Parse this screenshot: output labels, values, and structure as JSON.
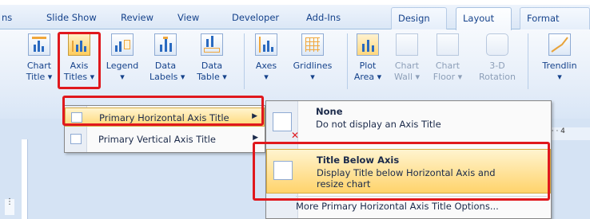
{
  "tabs": [
    "ns",
    "Slide Show",
    "Review",
    "View",
    "Developer",
    "Add-Ins",
    "Design",
    "Layout",
    "Format"
  ],
  "ribbon": {
    "chart_title": [
      "Chart",
      "Title ▾"
    ],
    "axis_titles": [
      "Axis",
      "Titles ▾"
    ],
    "legend": [
      "Legend",
      "▾"
    ],
    "data_labels": [
      "Data",
      "Labels ▾"
    ],
    "data_table": [
      "Data",
      "Table ▾"
    ],
    "axes": [
      "Axes",
      "▾"
    ],
    "gridlines": [
      "Gridlines",
      "▾"
    ],
    "plot_area": [
      "Plot",
      "Area ▾"
    ],
    "chart_wall": [
      "Chart",
      "Wall ▾"
    ],
    "chart_floor": [
      "Chart",
      "Floor ▾"
    ],
    "rotation": [
      "3-D",
      "Rotation"
    ],
    "trendline": [
      "Trendlin",
      "▾"
    ]
  },
  "menu1": {
    "items": [
      {
        "label": "Primary Horizontal Axis Title",
        "arrow": "▶"
      },
      {
        "label": "Primary Vertical Axis Title",
        "arrow": "▶"
      }
    ]
  },
  "menu2": {
    "none_title": "None",
    "none_desc": "Do not display an Axis Title",
    "below_title": "Title Below Axis",
    "below_desc1": "Display Title below Horizontal Axis and",
    "below_desc2": "resize chart",
    "more": "More Primary Horizontal Axis Title Options..."
  },
  "ruler_text": "· · · 4",
  "accent_colors": {
    "highlight": "#ffd977",
    "annotation_red": "#e0181d",
    "ribbon_blue": "#15428b"
  }
}
